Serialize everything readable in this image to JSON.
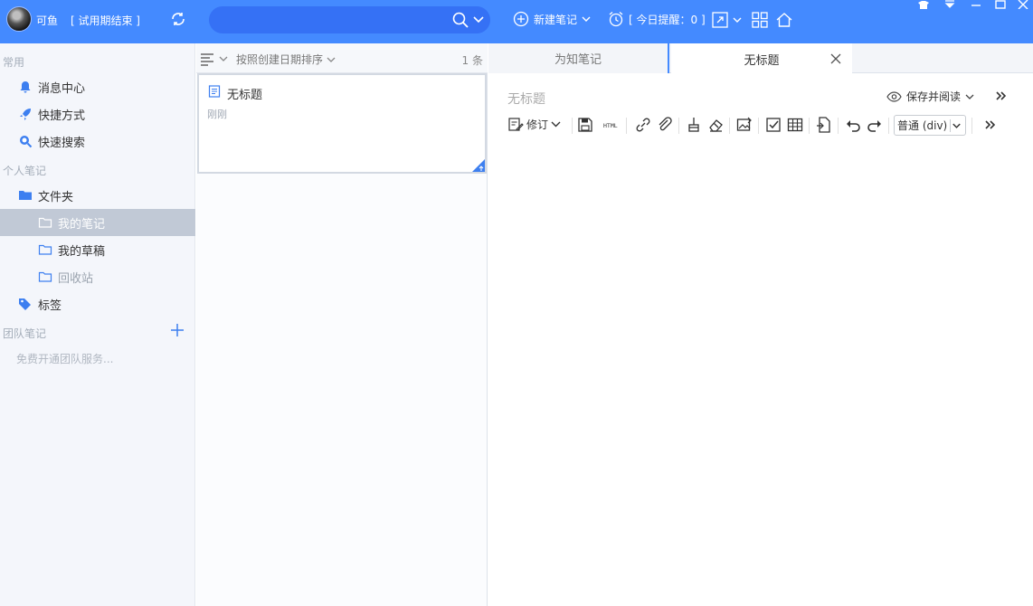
{
  "topbar": {
    "username": "可鱼",
    "trial_status": "[ 试用期结束 ]",
    "search_placeholder": "",
    "new_note_label": "新建笔记",
    "reminder_label": "[ 今日提醒：0 ]"
  },
  "sidebar": {
    "common_header": "常用",
    "common_items": [
      {
        "label": "消息中心",
        "icon": "bell-icon"
      },
      {
        "label": "快捷方式",
        "icon": "rocket-icon"
      },
      {
        "label": "快速搜索",
        "icon": "search-icon"
      }
    ],
    "personal_header": "个人笔记",
    "folder_root": "文件夹",
    "folders": [
      {
        "label": "我的笔记",
        "active": true
      },
      {
        "label": "我的草稿",
        "active": false
      },
      {
        "label": "回收站",
        "active": false
      }
    ],
    "tags_label": "标签",
    "team_header": "团队笔记",
    "team_tip": "免费开通团队服务..."
  },
  "notelist": {
    "sort_label": "按照创建日期排序",
    "count": "1 条",
    "notes": [
      {
        "title": "无标题",
        "time": "刚刚"
      }
    ]
  },
  "editor": {
    "tabs": [
      {
        "label": "为知笔记",
        "active": false
      },
      {
        "label": "无标题",
        "active": true
      }
    ],
    "doc_title": "无标题",
    "save_read_label": "保存并阅读",
    "revise_label": "修订",
    "format_value": "普通 (div)"
  },
  "colors": {
    "brand": "#448aff",
    "search_bg": "#3571f5",
    "sidebar_active": "#c1c9d6",
    "icon_blue": "#3d7ff0"
  }
}
